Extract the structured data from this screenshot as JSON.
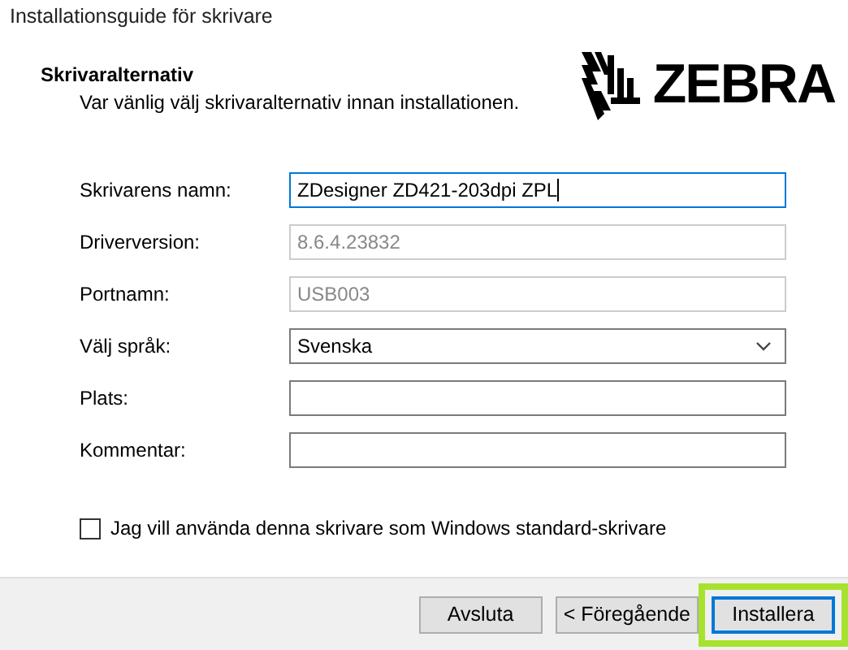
{
  "window": {
    "title": "Installationsguide för skrivare"
  },
  "header": {
    "heading": "Skrivaralternativ",
    "subtitle": "Var vänlig välj skrivaralternativ innan installationen.",
    "logo_text": "ZEBRA"
  },
  "fields": [
    {
      "kind": "text",
      "label": "Skrivarens namn:",
      "value": "ZDesigner ZD421-203dpi ZPL",
      "disabled": false,
      "focused": true
    },
    {
      "kind": "text",
      "label": "Driverversion:",
      "value": "8.6.4.23832",
      "disabled": true,
      "focused": false
    },
    {
      "kind": "text",
      "label": "Portnamn:",
      "value": "USB003",
      "disabled": true,
      "focused": false
    },
    {
      "kind": "dropdown",
      "label": "Välj språk:",
      "value": "Svenska",
      "disabled": false,
      "focused": false
    },
    {
      "kind": "text",
      "label": "Plats:",
      "disabled": false,
      "focused": false
    },
    {
      "kind": "text",
      "label": "Kommentar:",
      "disabled": false,
      "focused": false
    }
  ],
  "default_printer": {
    "label": "Jag vill använda denna skrivare som Windows standard-skrivare",
    "checked": false
  },
  "buttons": [
    {
      "label": "Avsluta",
      "default": false,
      "highlighted": false
    },
    {
      "label": "< Föregående",
      "default": false,
      "highlighted": false
    },
    {
      "label": "Installera",
      "default": true,
      "highlighted": true
    }
  ]
}
